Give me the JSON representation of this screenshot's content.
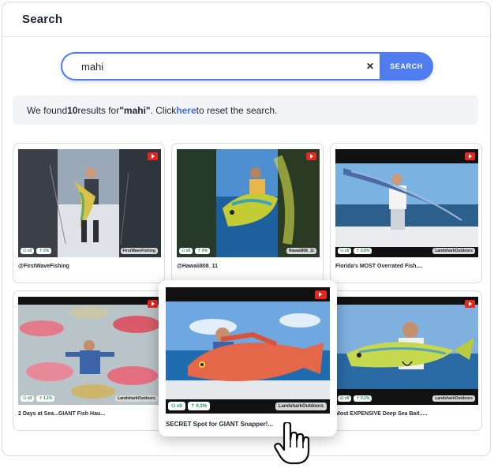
{
  "header": {
    "title": "Search"
  },
  "search": {
    "value": "mahi",
    "clear_icon": "close-icon",
    "button_label": "SEARCH"
  },
  "results": {
    "prefix": "We found ",
    "count": "10",
    "middle": " results for ",
    "query": "\"mahi\"",
    "middle2": ".  Click ",
    "link": "here",
    "suffix": " to reset the search."
  },
  "cards": [
    {
      "caption": "@FirstWaveFishing",
      "channel": "FirstWaveFishing",
      "stat1": "⚇ x0",
      "stat2": "⇡ 0%"
    },
    {
      "caption": "@Hawaii808_11",
      "channel": "Hawaii808_11",
      "stat1": "⚇ x0",
      "stat2": "⇡ 0%"
    },
    {
      "caption": "Florida's MOST Overrated Fish....",
      "channel": "LandsharkOutdoors",
      "stat1": "⚇ x0",
      "stat2": "⇡ 0.9%"
    },
    {
      "caption": "2 Days at Sea...GIANT Fish Hau...",
      "channel": "LandsharkOutdoors",
      "stat1": "⚇ x0",
      "stat2": "⇡ 1.1%"
    },
    {
      "caption": "SECRET Spot for GIANT Snapper!...",
      "channel": "LandsharkOutdoors",
      "stat1": "⚇ x0",
      "stat2": "⇡ 0.3%"
    },
    {
      "caption": "Most EXPENSIVE Deep Sea Bait.....",
      "channel": "LandsharkOutdoors",
      "stat1": "⚇ x0",
      "stat2": "⇡ 0.1%"
    }
  ],
  "colors": {
    "accent": "#4f7df0",
    "link": "#3d6fe8",
    "youtube": "#e6261f"
  }
}
